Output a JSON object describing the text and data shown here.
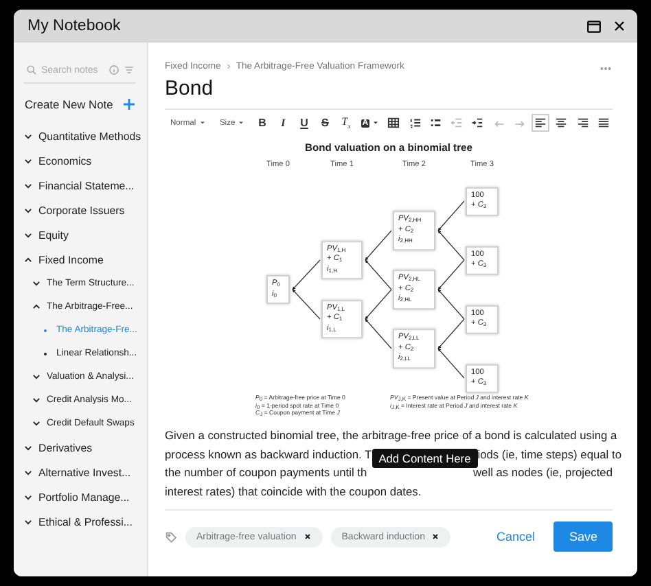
{
  "window": {
    "title": "My Notebook"
  },
  "sidebar": {
    "search": {
      "placeholder": "Search notes"
    },
    "create_label": "Create New Note",
    "items": [
      {
        "kind": "section",
        "label": "Quantitative Methods",
        "expanded": false,
        "selected": false
      },
      {
        "kind": "section",
        "label": "Economics",
        "expanded": false,
        "selected": false
      },
      {
        "kind": "section",
        "label": "Financial Stateme...",
        "expanded": false,
        "selected": false
      },
      {
        "kind": "section",
        "label": "Corporate Issuers",
        "expanded": false,
        "selected": false
      },
      {
        "kind": "section",
        "label": "Equity",
        "expanded": false,
        "selected": false
      },
      {
        "kind": "section",
        "label": "Fixed Income",
        "expanded": true,
        "selected": false,
        "children": [
          {
            "kind": "section",
            "label": "The Term Structure...",
            "expanded": false,
            "selected": false
          },
          {
            "kind": "section",
            "label": "The Arbitrage-Free...",
            "expanded": true,
            "selected": false,
            "children": [
              {
                "kind": "note",
                "label": "The Arbitrage-Fre...",
                "selected": true
              },
              {
                "kind": "note",
                "label": "Linear Relationsh...",
                "selected": false
              }
            ]
          },
          {
            "kind": "section",
            "label": "Valuation & Analysi...",
            "expanded": false,
            "selected": false
          },
          {
            "kind": "section",
            "label": "Credit Analysis Mo...",
            "expanded": false,
            "selected": false
          },
          {
            "kind": "section",
            "label": "Credit Default Swaps",
            "expanded": false,
            "selected": false
          }
        ]
      },
      {
        "kind": "section",
        "label": "Derivatives",
        "expanded": false,
        "selected": false
      },
      {
        "kind": "section",
        "label": "Alternative Invest...",
        "expanded": false,
        "selected": false
      },
      {
        "kind": "section",
        "label": "Portfolio Manage...",
        "expanded": false,
        "selected": false
      },
      {
        "kind": "section",
        "label": "Ethical & Professi...",
        "expanded": false,
        "selected": false
      }
    ]
  },
  "editor": {
    "breadcrumb": [
      "Fixed Income",
      "The Arbitrage-Free Valuation Framework"
    ],
    "title": "Bond",
    "toolbar": [
      {
        "kind": "format",
        "label": "Normal"
      },
      {
        "kind": "size",
        "label": "Size"
      },
      {
        "kind": "bold",
        "label": "B",
        "disabled": false
      },
      {
        "kind": "italic",
        "label": "I",
        "disabled": false
      },
      {
        "kind": "underline",
        "label": "U",
        "disabled": false
      },
      {
        "kind": "strike",
        "label": "S",
        "disabled": false
      },
      {
        "kind": "clear-format",
        "label": "T$_{x}$",
        "disabled": false
      },
      {
        "kind": "text-color",
        "label": "A",
        "disabled": false
      },
      {
        "kind": "table",
        "disabled": false
      },
      {
        "kind": "numbered-list",
        "disabled": false
      },
      {
        "kind": "bullet-list",
        "disabled": false
      },
      {
        "kind": "outdent",
        "disabled": true
      },
      {
        "kind": "indent",
        "disabled": false
      },
      {
        "kind": "undo",
        "disabled": true
      },
      {
        "kind": "redo",
        "disabled": true
      },
      {
        "kind": "align-left",
        "disabled": false,
        "selected": true
      },
      {
        "kind": "align-center",
        "disabled": false,
        "selected": false
      },
      {
        "kind": "align-right",
        "disabled": false,
        "selected": false
      },
      {
        "kind": "justify",
        "disabled": false,
        "selected": false
      }
    ],
    "figure": {
      "title": "Bond valuation on a binomial tree",
      "columns": [
        {
          "label": "Time 0",
          "nodes": [
            [
              "*P*$_{0}$",
              "*i*$_{0}$"
            ]
          ]
        },
        {
          "label": "Time 1",
          "nodes": [
            [
              "*PV*$_{1,H}$",
              "+ *C*$_{1}$",
              "*i*$_{1,H}$"
            ],
            [
              "*PV*$_{1,L}$",
              "+ *C*$_{1}$",
              "*i*$_{1,L}$"
            ]
          ]
        },
        {
          "label": "Time 2",
          "nodes": [
            [
              "*PV*$_{2,HH}$",
              "+ *C*$_{2}$",
              "*i*$_{2,HH}$"
            ],
            [
              "*PV*$_{2,HL}$",
              "+ *C*$_{2}$",
              "*i*$_{2,HL}$"
            ],
            [
              "*PV*$_{2,LL}$",
              "+ *C*$_{2}$",
              "*i*$_{2,LL}$"
            ]
          ]
        },
        {
          "label": "Time 3",
          "nodes": [
            [
              "100",
              "+ *C*$_{3}$"
            ],
            [
              "100",
              "+ *C*$_{3}$"
            ],
            [
              "100",
              "+ *C*$_{3}$"
            ],
            [
              "100",
              "+ *C*$_{3}$"
            ]
          ]
        }
      ],
      "legend_left": [
        "*P*$_{0}$ = Arbitrage-free price at Time 0",
        "*i*$_{0}$ = 1-period spot rate at Time 0",
        "*C*$_{J}$ = Coupon payment at Time *J*"
      ],
      "legend_right": [
        "*PV*$_{J,K}$ = Present value at Period *J* and interest rate *K*",
        "*i*$_{J,K}$ = Interest rate at Period *J* and interest rate *K*"
      ]
    },
    "paragraph_lines": [
      [
        "Given a constructed binomial tree, the arbitrage-free price of a bond is calculated using a"
      ],
      [
        "process known as backward induction. T",
        "iods (ie, time steps) equal to"
      ],
      [
        "the number of coupon payments until th",
        "well as nodes (ie, projected"
      ],
      [
        "interest rates) that coincide with the coupon dates."
      ]
    ],
    "tooltip": "Add Content Here",
    "tags": [
      "Arbitrage-free valuation",
      "Backward induction"
    ],
    "buttons": {
      "cancel": "Cancel",
      "save": "Save"
    }
  }
}
